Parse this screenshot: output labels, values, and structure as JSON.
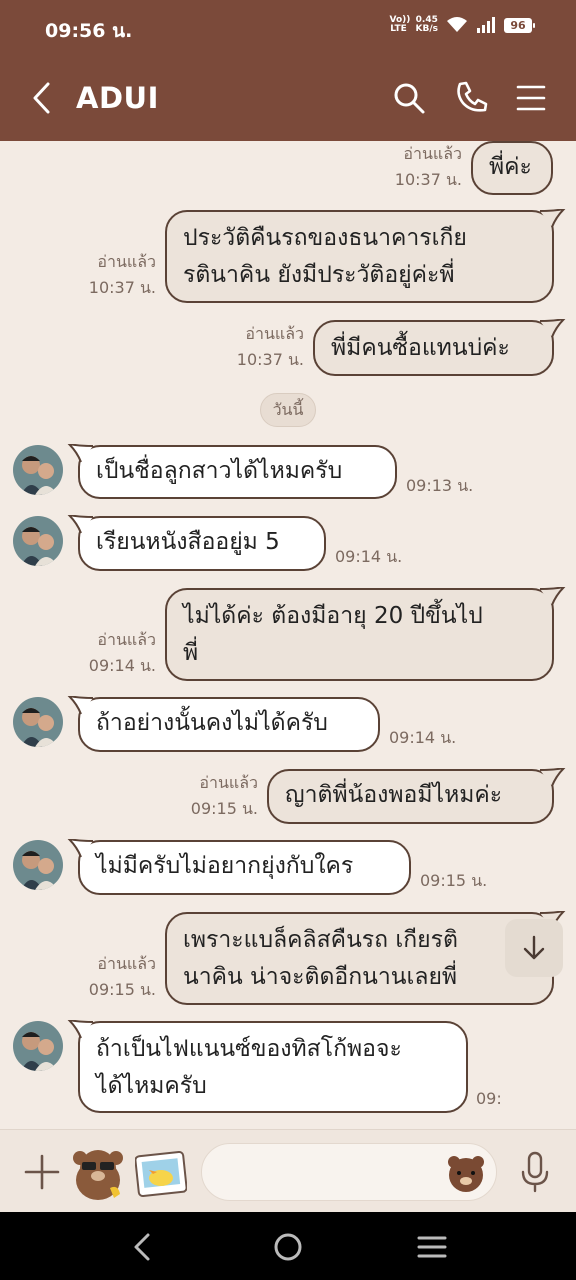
{
  "status": {
    "time": "09:56 น.",
    "net_top": "Vo)) LTE",
    "speed_value": "0.45",
    "speed_unit": "KB/s",
    "battery": "96"
  },
  "header": {
    "title": "ADUI"
  },
  "day_separator": "วันนี้",
  "messages": [
    {
      "id": "m1",
      "side": "out",
      "text": "พี่ค่ะ",
      "read": "อ่านแล้ว",
      "time": "10:37 น."
    },
    {
      "id": "m2",
      "side": "out",
      "text": "ประวัติคืนรถของธนาคารเกีย\nรตินาคิน ยังมีประวัติอยู่ค่ะพี่",
      "read": "อ่านแล้ว",
      "time": "10:37 น."
    },
    {
      "id": "m3",
      "side": "out",
      "text": "พี่มีคนซื้อแทนบ่ค่ะ",
      "read": "อ่านแล้ว",
      "time": "10:37 น."
    },
    {
      "id": "m4",
      "side": "in",
      "text": "เป็นชื่อลูกสาวได้ไหมครับ",
      "time": "09:13 น."
    },
    {
      "id": "m5",
      "side": "in",
      "text": "เรียนหนังสืออยู่ม 5",
      "time": "09:14 น."
    },
    {
      "id": "m6",
      "side": "out",
      "text": "ไม่ได้ค่ะ ต้องมีอายุ 20 ปีขึ้นไป\nพี่",
      "read": "อ่านแล้ว",
      "time": "09:14 น."
    },
    {
      "id": "m7",
      "side": "in",
      "text": "ถ้าอย่างนั้นคงไม่ได้ครับ",
      "time": "09:14 น."
    },
    {
      "id": "m8",
      "side": "out",
      "text": "ญาติพี่น้องพอมีไหมค่ะ",
      "read": "อ่านแล้ว",
      "time": "09:15 น."
    },
    {
      "id": "m9",
      "side": "in",
      "text": "ไม่มีครับไม่อยากยุ่งกับใคร",
      "time": "09:15 น."
    },
    {
      "id": "m10",
      "side": "out",
      "text": "เพราะแบล็คลิสคืนรถ เกียรติ\nนาคิน น่าจะติดอีกนานเลยพี่",
      "read": "อ่านแล้ว",
      "time": "09:15 น."
    },
    {
      "id": "m11",
      "side": "in",
      "text": "ถ้าเป็นไฟแนนซ์ของทิสโก้พอจะ\nได้ไหมครับ",
      "time": "09:"
    }
  ],
  "input": {
    "placeholder": ""
  },
  "colors": {
    "header": "#7b4a3a",
    "chat_bg": "#f3ebe4",
    "bubble_out": "#ece3da",
    "bubble_in": "#ffffff",
    "border": "#5a4236"
  },
  "icons": [
    "back-icon",
    "search-icon",
    "phone-icon",
    "menu-icon",
    "plus-icon",
    "brown-bear-sticker-icon",
    "sally-sticker-icon",
    "emoji-bear-icon",
    "mic-icon",
    "scroll-down-icon",
    "nav-back-icon",
    "nav-home-icon",
    "nav-recents-icon"
  ]
}
